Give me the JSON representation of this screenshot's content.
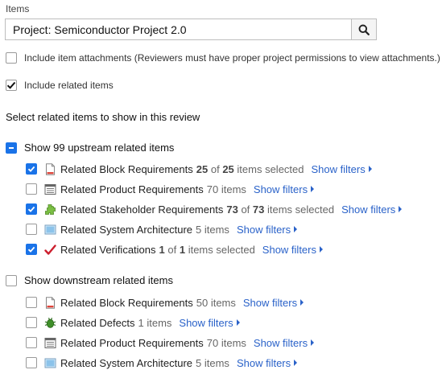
{
  "items_label": "Items",
  "search": {
    "value": "Project: Semiconductor Project 2.0"
  },
  "options": {
    "attachments": {
      "label": "Include item attachments (Reviewers must have proper project permissions to view attachments.)",
      "checked": false
    },
    "related": {
      "label": "Include related items",
      "checked": true
    }
  },
  "select_heading": "Select related items to show in this review",
  "upstream": {
    "label": "Show 99 upstream related items",
    "state": "indeterminate",
    "items": [
      {
        "name": "Related Block Requirements",
        "icon": "block-requirement-icon",
        "checked": true,
        "count_a": "25",
        "count_of": "of",
        "count_b": "25",
        "count_suffix": "items selected",
        "filters": "Show filters"
      },
      {
        "name": "Related Product Requirements",
        "icon": "product-requirement-icon",
        "checked": false,
        "count_text": "70 items",
        "filters": "Show filters"
      },
      {
        "name": "Related Stakeholder Requirements",
        "icon": "stakeholder-requirement-icon",
        "checked": true,
        "count_a": "73",
        "count_of": "of",
        "count_b": "73",
        "count_suffix": "items selected",
        "filters": "Show filters"
      },
      {
        "name": "Related System Architecture",
        "icon": "system-architecture-icon",
        "checked": false,
        "count_text": "5 items",
        "filters": "Show filters"
      },
      {
        "name": "Related Verifications",
        "icon": "verification-checkmark-icon",
        "checked": true,
        "count_a": "1",
        "count_of": "of",
        "count_b": "1",
        "count_suffix": "items selected",
        "filters": "Show filters"
      }
    ]
  },
  "downstream": {
    "label": "Show downstream related items",
    "state": "unchecked",
    "items": [
      {
        "name": "Related Block Requirements",
        "icon": "block-requirement-icon",
        "checked": false,
        "count_text": "50 items",
        "filters": "Show filters"
      },
      {
        "name": "Related Defects",
        "icon": "defect-bug-icon",
        "checked": false,
        "count_text": "1 items",
        "filters": "Show filters"
      },
      {
        "name": "Related Product Requirements",
        "icon": "product-requirement-icon",
        "checked": false,
        "count_text": "70 items",
        "filters": "Show filters"
      },
      {
        "name": "Related System Architecture",
        "icon": "system-architecture-icon",
        "checked": false,
        "count_text": "5 items",
        "filters": "Show filters"
      }
    ]
  },
  "colors": {
    "accent": "#1a73e8",
    "link": "#2a62c9"
  }
}
